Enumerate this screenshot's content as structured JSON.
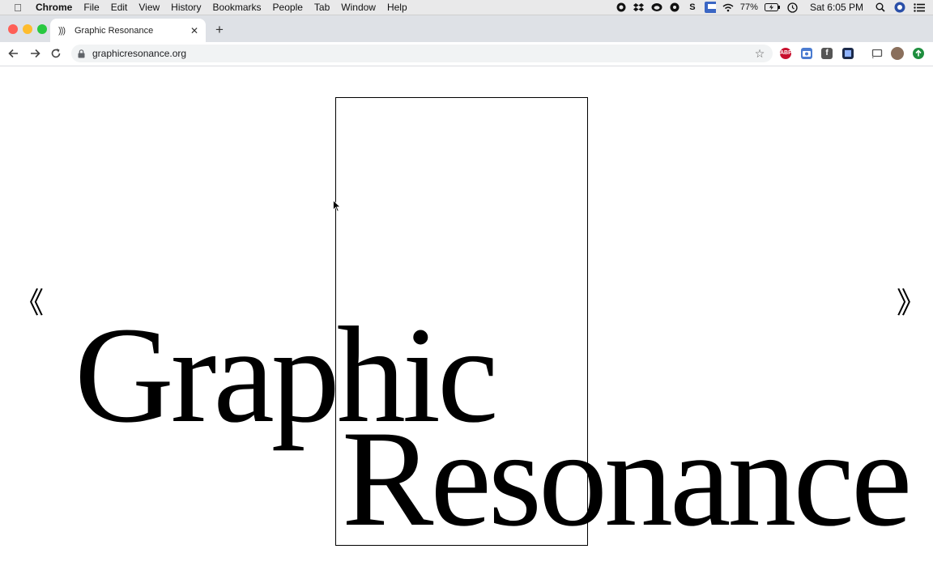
{
  "menubar": {
    "app": "Chrome",
    "items": [
      "File",
      "Edit",
      "View",
      "History",
      "Bookmarks",
      "People",
      "Tab",
      "Window",
      "Help"
    ],
    "battery": "77%",
    "clock": "Sat 6:05 PM"
  },
  "tab": {
    "title": "Graphic Resonance",
    "favicon": ")))"
  },
  "address_bar": {
    "url": "graphicresonance.org"
  },
  "extensions": {
    "adblock_label": "ABP"
  },
  "page": {
    "prev_arrow": "《",
    "next_arrow": "》",
    "title_word_1": "Graphic",
    "title_word_2": "Resonance"
  },
  "colors": {
    "traffic_red": "#fe5f57",
    "traffic_yellow": "#febc2e",
    "traffic_green": "#28c840",
    "page_bg": "#ffffff",
    "text": "#000000"
  }
}
